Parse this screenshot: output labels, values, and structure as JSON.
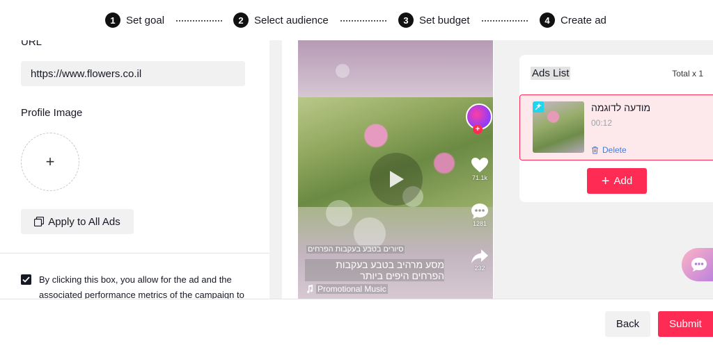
{
  "stepper": {
    "steps": [
      {
        "num": "1",
        "label": "Set goal"
      },
      {
        "num": "2",
        "label": "Select audience"
      },
      {
        "num": "3",
        "label": "Set budget"
      },
      {
        "num": "4",
        "label": "Create ad"
      }
    ]
  },
  "form": {
    "url_label": "URL",
    "url_value": "https://www.flowers.co.il",
    "profile_image_label": "Profile Image",
    "profile_upload_symbol": "+",
    "apply_button": "Apply to All Ads",
    "consent_checked": true,
    "consent_text": "By clicking this box, you allow for the ad and the associated performance metrics of the campaign to"
  },
  "preview": {
    "like_count": "71.1k",
    "comment_count": "1281",
    "share_count": "232",
    "sponsor_name": "סיורים בטבע בעקבות הפרחים",
    "caption": "מסע מרהיב בטבע בעקבות הפרחים היפים ביותר",
    "music_label": "Promotional Music"
  },
  "ads_list": {
    "title": "Ads List",
    "total": "Total x 1",
    "items": [
      {
        "name": "מודעה לדוגמה",
        "duration": "00:12",
        "delete_label": "Delete"
      }
    ],
    "add_label": "Add"
  },
  "footer": {
    "back_label": "Back",
    "submit_label": "Submit"
  },
  "colors": {
    "accent": "#fe2c55",
    "link": "#4a7bd6",
    "panel_bg": "#f1f1f2"
  }
}
